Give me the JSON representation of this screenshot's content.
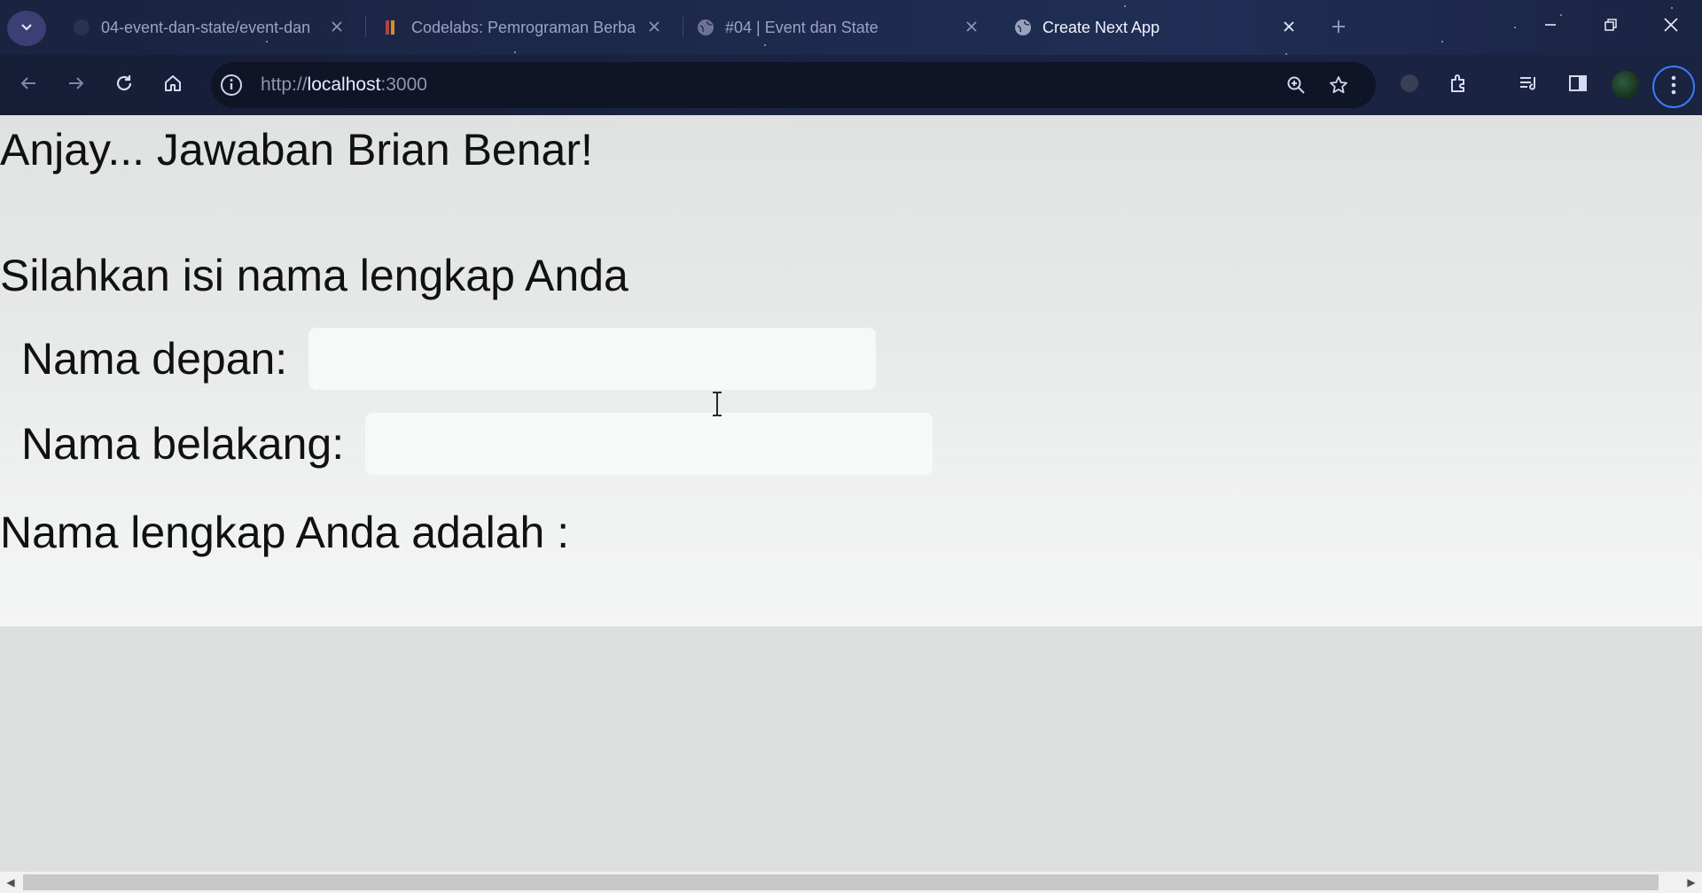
{
  "tabs": [
    {
      "title": "04-event-dan-state/event-dan",
      "icon": "github-icon",
      "active": false
    },
    {
      "title": "Codelabs: Pemrograman Berba",
      "icon": "codelabs-icon",
      "active": false
    },
    {
      "title": "#04 | Event dan State",
      "icon": "globe-icon",
      "active": false
    },
    {
      "title": "Create Next App",
      "icon": "globe-icon",
      "active": true
    }
  ],
  "address_bar": {
    "scheme": "http://",
    "host": "localhost",
    "port": ":3000"
  },
  "page": {
    "result_heading": "Anjay... Jawaban Brian Benar!",
    "prompt_heading": "Silahkan isi nama lengkap Anda",
    "first_name": {
      "label": "Nama depan:",
      "value": "",
      "placeholder": ""
    },
    "last_name": {
      "label": "Nama belakang:",
      "value": "",
      "placeholder": ""
    },
    "full_name_text": "Nama lengkap Anda adalah :"
  },
  "colors": {
    "chrome_dark": "#1a2340",
    "omnibox_bg": "#0f1426",
    "page_bg": "#e9eaea",
    "focus_ring": "#3a7bff"
  }
}
